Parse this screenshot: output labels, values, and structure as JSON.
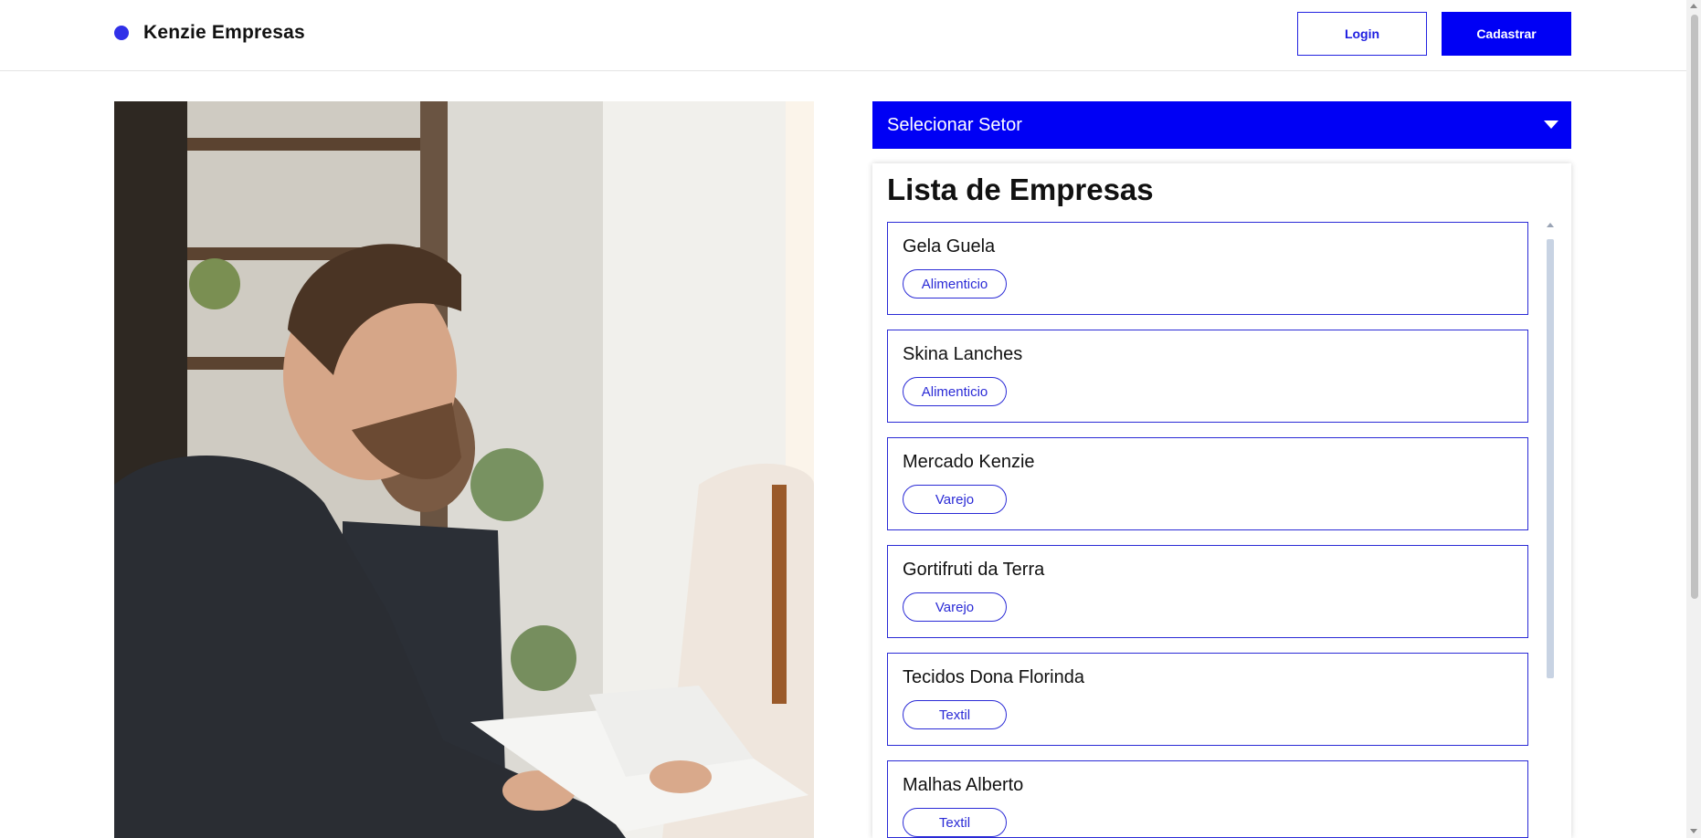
{
  "header": {
    "brand": "Kenzie Empresas",
    "login_label": "Login",
    "register_label": "Cadastrar",
    "accent_color": "#0000f5"
  },
  "hero": {
    "image_icon": "business-meeting-photo"
  },
  "filter": {
    "label": "Selecionar Setor",
    "icon": "caret-down-icon"
  },
  "companies": {
    "title": "Lista de Empresas",
    "items": [
      {
        "name": "Gela Guela",
        "sector": "Alimenticio"
      },
      {
        "name": "Skina Lanches",
        "sector": "Alimenticio"
      },
      {
        "name": "Mercado Kenzie",
        "sector": "Varejo"
      },
      {
        "name": "Gortifruti da Terra",
        "sector": "Varejo"
      },
      {
        "name": "Tecidos Dona Florinda",
        "sector": "Textil"
      },
      {
        "name": "Malhas Alberto",
        "sector": "Textil"
      }
    ]
  }
}
